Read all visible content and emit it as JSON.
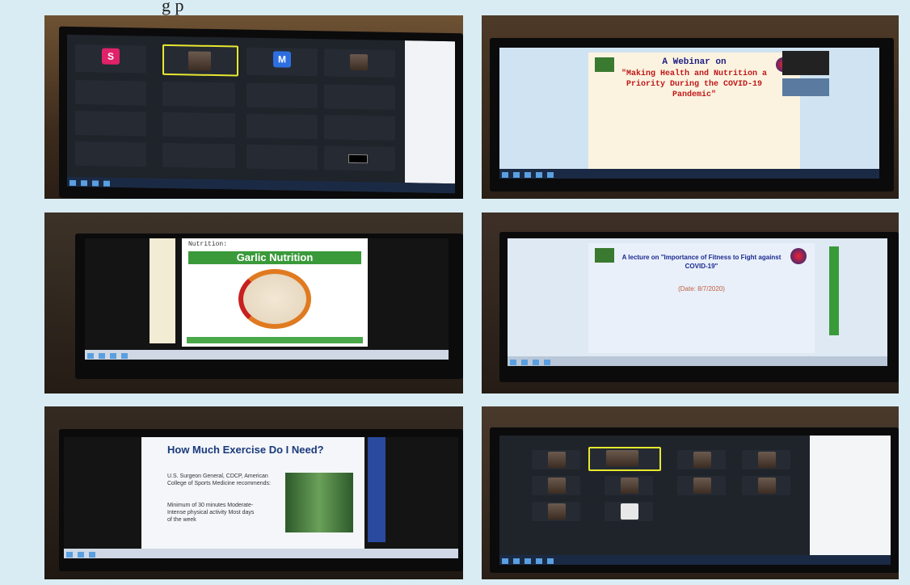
{
  "photos": {
    "p1": {
      "tiles": [
        "S",
        "M"
      ]
    },
    "p2": {
      "title": "A Webinar on",
      "subtitle": "\"Making Health and Nutrition a Priority During the COVID-19 Pandemic\""
    },
    "p3": {
      "label": "Nutrition:",
      "title": "Garlic Nutrition"
    },
    "p4": {
      "title": "A lecture on \"Importance of Fitness to Fight against COVID-19\"",
      "date": "(Date: 8/7/2020)"
    },
    "p5": {
      "title": "How Much Exercise Do I Need?",
      "body": "U.S. Surgeon General, CDCP, American College of Sports Medicine recommends:",
      "body2": "Minimum of 30 minutes Moderate-Intense physical activity Most days of the week"
    }
  },
  "colors": {
    "zoom_bg": "#1f232a",
    "accent_yellow": "#e8e830",
    "garlic_green": "#3a9a3a",
    "exercise_blue": "#1a3a7a"
  }
}
